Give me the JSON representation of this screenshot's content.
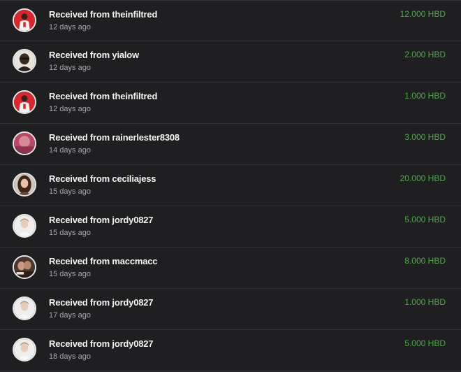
{
  "transfers": [
    {
      "prefix": "Received from",
      "user": "theinfiltred",
      "time": "12 days ago",
      "amount": "12.000 HBD",
      "avatar": "red-player",
      "accent": "#d7282f"
    },
    {
      "prefix": "Received from",
      "user": "yialow",
      "time": "12 days ago",
      "amount": "2.000 HBD",
      "avatar": "dark-portrait",
      "accent": "#3a2a22"
    },
    {
      "prefix": "Received from",
      "user": "theinfiltred",
      "time": "12 days ago",
      "amount": "1.000 HBD",
      "avatar": "red-player",
      "accent": "#d7282f"
    },
    {
      "prefix": "Received from",
      "user": "rainerlester8308",
      "time": "14 days ago",
      "amount": "3.000 HBD",
      "avatar": "pink-blur",
      "accent": "#c9647a"
    },
    {
      "prefix": "Received from",
      "user": "ceciliajess",
      "time": "15 days ago",
      "amount": "20.000 HBD",
      "avatar": "woman-portrait",
      "accent": "#6b4a36"
    },
    {
      "prefix": "Received from",
      "user": "jordy0827",
      "time": "15 days ago",
      "amount": "5.000 HBD",
      "avatar": "light-portrait",
      "accent": "#d9d4cc"
    },
    {
      "prefix": "Received from",
      "user": "maccmacc",
      "time": "15 days ago",
      "amount": "8.000 HBD",
      "avatar": "couple-photo",
      "accent": "#5a4038"
    },
    {
      "prefix": "Received from",
      "user": "jordy0827",
      "time": "17 days ago",
      "amount": "1.000 HBD",
      "avatar": "light-portrait",
      "accent": "#d9d4cc"
    },
    {
      "prefix": "Received from",
      "user": "jordy0827",
      "time": "18 days ago",
      "amount": "5.000 HBD",
      "avatar": "light-portrait",
      "accent": "#d9d4cc"
    }
  ],
  "colors": {
    "background": "#1f1f22",
    "divider": "#34353a",
    "amount": "#4fa84b",
    "title": "#f2f2f2",
    "time": "#a9a9ad"
  }
}
